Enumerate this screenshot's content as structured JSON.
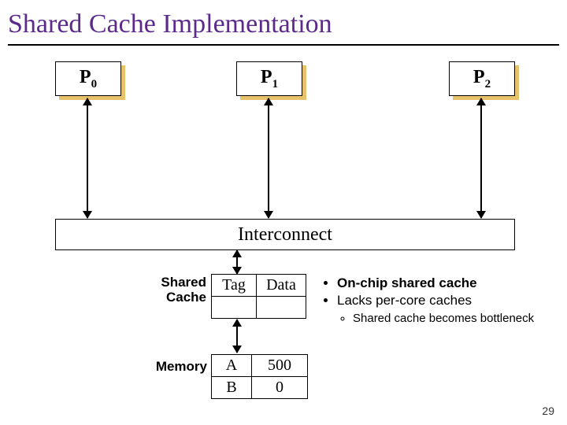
{
  "title": "Shared Cache Implementation",
  "processors": [
    {
      "letter": "P",
      "index": "0"
    },
    {
      "letter": "P",
      "index": "1"
    },
    {
      "letter": "P",
      "index": "2"
    }
  ],
  "interconnect_label": "Interconnect",
  "shared_cache_label_line1": "Shared",
  "shared_cache_label_line2": "Cache",
  "memory_label": "Memory",
  "cache_table": {
    "header": [
      "Tag",
      "Data"
    ],
    "rows": [
      [
        "",
        ""
      ]
    ]
  },
  "memory_table": {
    "rows": [
      [
        "A",
        "500"
      ],
      [
        "B",
        "0"
      ]
    ]
  },
  "bullets": {
    "b1": "On-chip shared cache",
    "b2": "Lacks per-core caches",
    "b2a": "Shared cache becomes bottleneck"
  },
  "page_number": "29"
}
